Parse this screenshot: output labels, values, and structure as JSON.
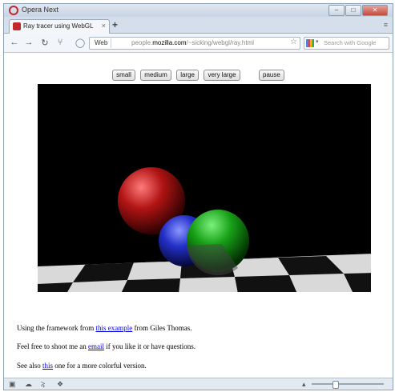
{
  "window": {
    "app_title": "Opera Next",
    "controls": {
      "minimize": "–",
      "maximize": "□",
      "close": "✕"
    }
  },
  "tabs": [
    {
      "label": "Ray tracer using WebGL",
      "close": "×"
    }
  ],
  "new_tab": "+",
  "toolbar": {
    "back": "←",
    "forward": "→",
    "reload": "↻",
    "key": "⑂",
    "web_badge": "Web",
    "url_prefix": "people.",
    "url_domain": "mozilla.com",
    "url_suffix": "/~sicking/webgl/ray.html",
    "star": "☆",
    "search_placeholder": "Search with Google"
  },
  "page": {
    "buttons": [
      "small",
      "medium",
      "large",
      "very large"
    ],
    "pause_label": "pause",
    "para1": {
      "before": "Using the framework from ",
      "link": "this example",
      "after": " from Giles Thomas."
    },
    "para2": {
      "before": "Feel free to shoot me an ",
      "link": "email",
      "after": " if you like it or have questions."
    },
    "para3": {
      "before": "See also ",
      "link": "this",
      "after": " one for a more colorful version."
    }
  },
  "scene": {
    "background": "#000000",
    "floor_light": "#d9d9d9",
    "floor_dark": "#111111",
    "spheres": [
      {
        "name": "red-sphere",
        "color": "#c41818"
      },
      {
        "name": "blue-sphere",
        "color": "#2a35d8"
      },
      {
        "name": "green-sphere",
        "color": "#1fb81f"
      }
    ]
  }
}
